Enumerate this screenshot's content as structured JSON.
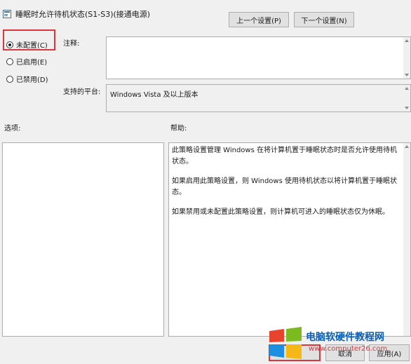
{
  "dialog": {
    "title": "睡眠时允许待机状态(S1-S3)(接通电源)"
  },
  "nav": {
    "prev_label": "上一个设置(P)",
    "next_label": "下一个设置(N)"
  },
  "state": {
    "options": [
      {
        "label": "未配置(C)",
        "checked": true
      },
      {
        "label": "已启用(E)",
        "checked": false
      },
      {
        "label": "已禁用(D)",
        "checked": false
      }
    ]
  },
  "comment": {
    "label": "注释:",
    "value": ""
  },
  "platform": {
    "label": "支持的平台:",
    "value": "Windows Vista 及以上版本"
  },
  "options_panel": {
    "label": "选项:"
  },
  "help": {
    "label": "帮助:",
    "paragraphs": [
      "此策略设置管理 Windows 在将计算机置于睡眠状态时是否允许使用待机状态。",
      "如果启用此策略设置，则 Windows 使用待机状态以将计算机置于睡眠状态。",
      "如果禁用或未配置此策略设置，则计算机可进入的睡眠状态仅为休眠。"
    ]
  },
  "footer": {
    "cancel_label": "取消",
    "apply_label": "应用(A)"
  },
  "watermark": {
    "title": "电脑软硬件教程网",
    "url": "www.computer26.com",
    "colors": {
      "red": "#e8432c",
      "green": "#7cbb1f",
      "blue": "#1e8fe0",
      "yellow": "#f6b817"
    }
  }
}
